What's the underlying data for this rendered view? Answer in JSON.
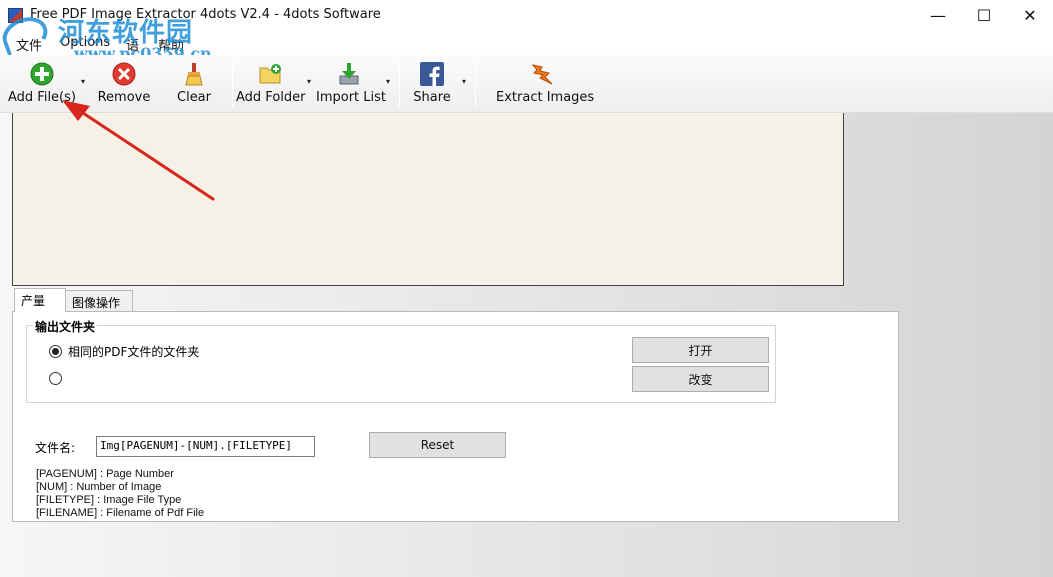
{
  "window": {
    "title": "Free PDF Image Extractor 4dots V2.4 - 4dots Software",
    "minimize": "—",
    "maximize": "☐",
    "close": "✕"
  },
  "watermark": {
    "text_cn": "河东软件园",
    "url": "www.pc0359.cn"
  },
  "menu": [
    "文件",
    "Options",
    "语",
    "帮助"
  ],
  "toolbar": {
    "add_files": "Add File(s)",
    "remove": "Remove",
    "clear": "Clear",
    "add_folder": "Add Folder",
    "import_list": "Import List",
    "share": "Share",
    "extract_images": "Extract Images",
    "dropdown_glyph": "▾"
  },
  "tabs": [
    "产量",
    "图像操作"
  ],
  "output_folder": {
    "title": "输出文件夹",
    "option_same": "相同的PDF文件的文件夹",
    "option_custom": "",
    "open_button": "打开",
    "change_button": "改变"
  },
  "filename": {
    "label": "文件名:",
    "value": "Img[PAGENUM]-[NUM].[FILETYPE]",
    "reset_button": "Reset"
  },
  "help_lines": [
    "[PAGENUM] : Page Number",
    "[NUM] : Number of Image",
    "[FILETYPE] : Image File Type",
    "[FILENAME] : Filename of Pdf File"
  ],
  "colors": {
    "file_panel_bg": "#f5f1e6",
    "annotation_arrow": "#d9261c",
    "watermark": "#1f8fd6"
  }
}
